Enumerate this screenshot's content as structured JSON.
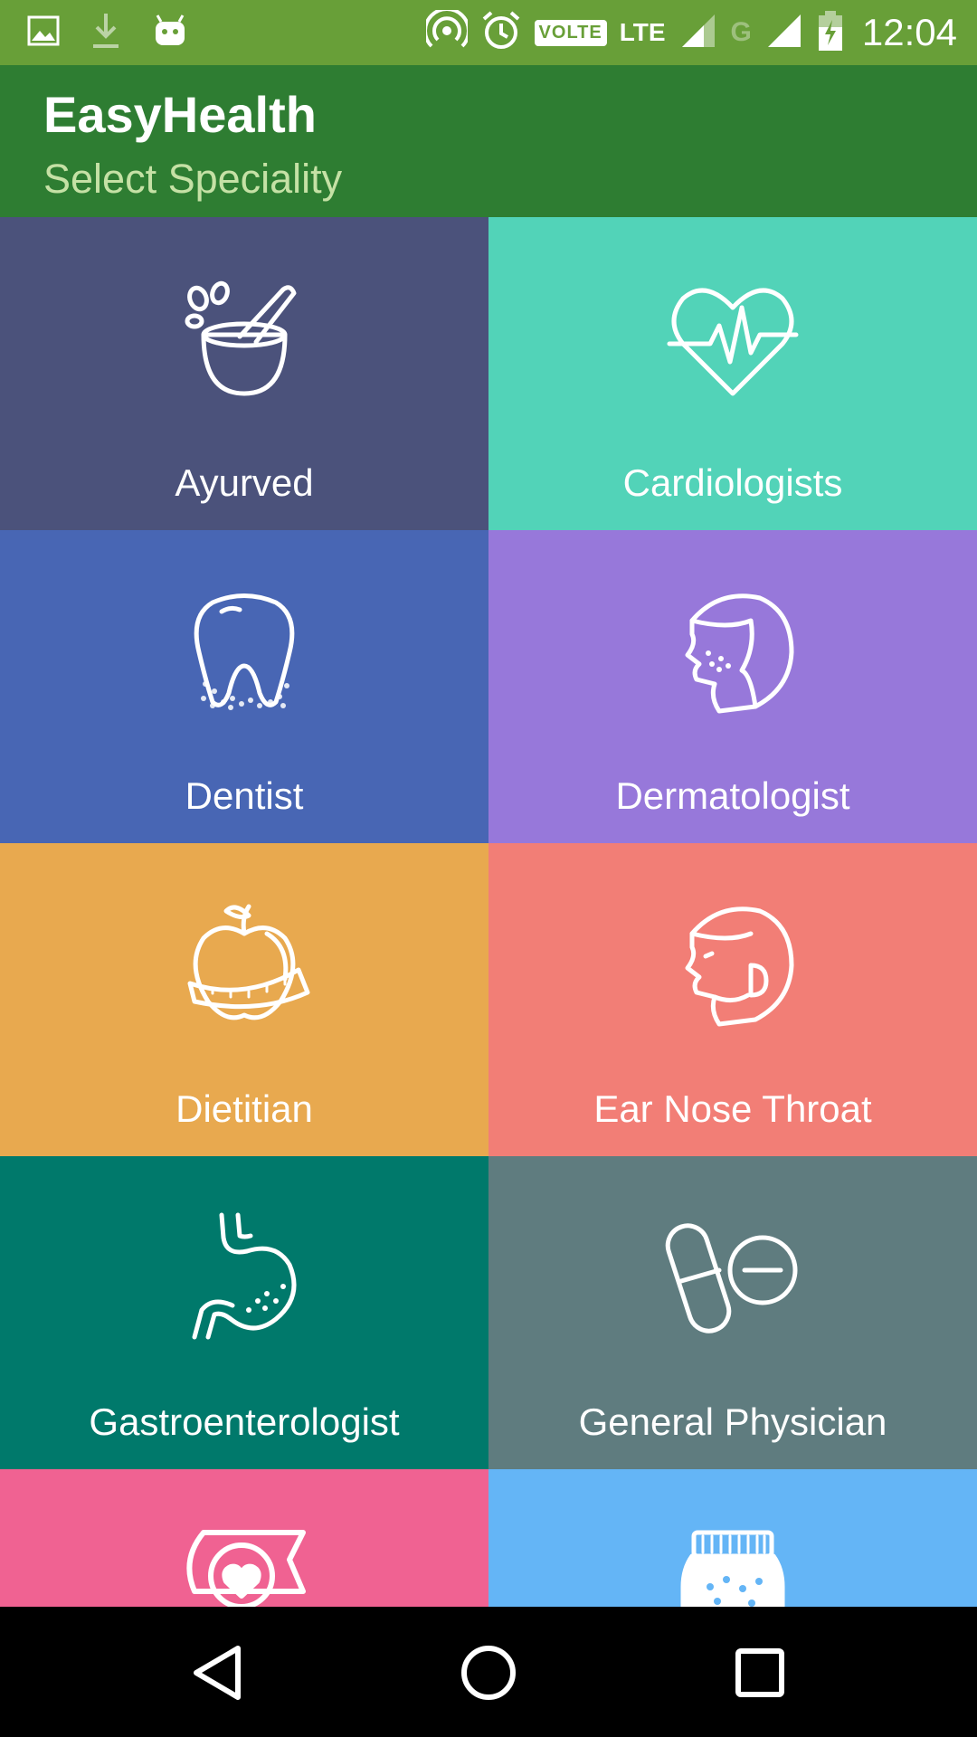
{
  "status_bar": {
    "time": "12:04",
    "volte": "VOLTE",
    "lte": "LTE",
    "g": "G",
    "icons": [
      "image-icon",
      "download-icon",
      "android-icon",
      "hotspot-icon",
      "alarm-icon",
      "volte-icon",
      "lte-icon",
      "signal-icon",
      "signal-g-icon",
      "battery-icon"
    ]
  },
  "app_bar": {
    "title": "EasyHealth",
    "subtitle": "Select Speciality"
  },
  "specialities": [
    {
      "label": "Ayurved",
      "color": "#4B527B",
      "icon": "mortar-pestle-icon"
    },
    {
      "label": "Cardiologists",
      "color": "#52D3B8",
      "icon": "heart-pulse-icon"
    },
    {
      "label": "Dentist",
      "color": "#4866B4",
      "icon": "tooth-icon"
    },
    {
      "label": "Dermatologist",
      "color": "#9778DA",
      "icon": "face-skin-icon"
    },
    {
      "label": "Dietitian",
      "color": "#E8A94F",
      "icon": "apple-tape-icon"
    },
    {
      "label": "Ear Nose Throat",
      "color": "#F27E76",
      "icon": "face-ent-icon"
    },
    {
      "label": "Gastroenterologist",
      "color": "#00796B",
      "icon": "stomach-icon"
    },
    {
      "label": "General Physician",
      "color": "#5F7C7F",
      "icon": "pills-icon"
    },
    {
      "label": "",
      "color": "#F06292",
      "icon": "heart-bag-icon"
    },
    {
      "label": "",
      "color": "#64B5F6",
      "icon": "medicine-jar-icon"
    }
  ],
  "nav_bar": {
    "icons": [
      "back-icon",
      "home-icon",
      "recents-icon"
    ]
  }
}
